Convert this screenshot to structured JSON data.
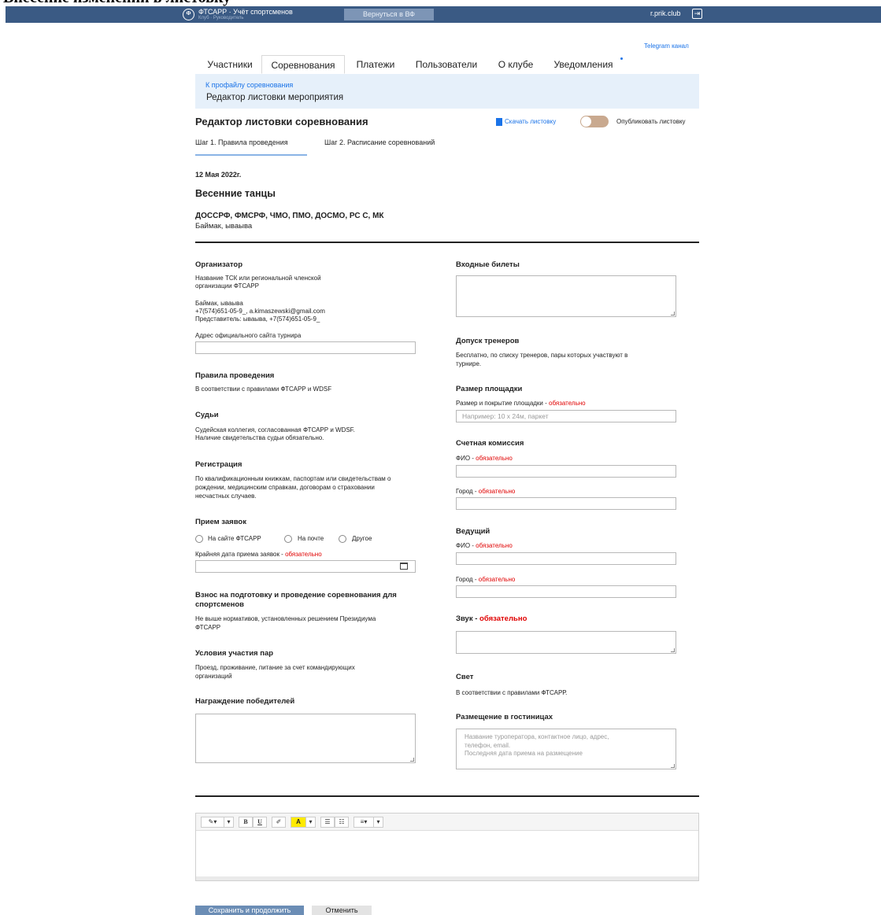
{
  "top_cut_text": "Внесение изменений в листовку",
  "topbar": {
    "logo_glyph": "Ф",
    "app_title": "ФТСАРР · Учёт спортсменов",
    "app_subtitle": "Клуб · Руководитель",
    "back_button": "Вернуться в ВФ",
    "user": "r.prik.club",
    "logout_glyph": "⇥"
  },
  "telegram_link": "Telegram канал",
  "nav": {
    "tabs": [
      {
        "label": "Участники"
      },
      {
        "label": "Соревнования"
      },
      {
        "label": "Платежи"
      },
      {
        "label": "Пользователи"
      },
      {
        "label": "О клубе"
      },
      {
        "label": "Уведомления"
      }
    ],
    "active_tab": "Соревнования"
  },
  "breadcrumb": {
    "link": "К профайлу соревнования",
    "current": "Редактор листовки мероприятия"
  },
  "page": {
    "title": "Редактор листовки соревнования",
    "download": "Скачать листовку",
    "publish_label": "Опубликовать листовку",
    "publish_on": false
  },
  "steps": [
    "Шаг 1. Правила проведения",
    "Шаг 2. Расписание соревнований"
  ],
  "event": {
    "date": "12 Мая 2022г.",
    "name": "Весенние танцы",
    "orgs": "ДОССРФ, ФМСРФ, ЧМО, ПМО, ДОСМО, РС С, МК",
    "place": "Баймак, ываыва"
  },
  "left": {
    "organizer": {
      "heading": "Организатор",
      "line1": "Название ТСК или региональной членской",
      "line2": "организации ФТСАРР",
      "line3": "Баймак, ываыва",
      "line4": "+7(574)651-05-9_, a.kimaszewski@gmail.com",
      "line5": "Представитель: ываыва, +7(574)651-05-9_"
    },
    "site_label": "Адрес официального сайта турнира",
    "site_value": "",
    "rules": {
      "heading": "Правила проведения",
      "text": "В соответствии с правилами ФТСАРР и WDSF"
    },
    "judges": {
      "heading": "Судьи",
      "line1": "Судейская коллегия, согласованная ФТСАРР и WDSF.",
      "line2": "Наличие свидетельства судьи обязательно."
    },
    "registration": {
      "heading": "Регистрация",
      "line1": "По квалификационным книжкам, паспортам или свидетельствам о",
      "line2": "рождении, медицинским справкам, договорам о страховании",
      "line3": "несчастных случаев."
    },
    "applications": {
      "heading": "Прием заявок",
      "options": [
        "На сайте ФТСАРР",
        "На почте",
        "Другое"
      ],
      "deadline_label": "Крайняя дата приема заявок",
      "required": "обязательно",
      "deadline_value": ""
    },
    "fee": {
      "heading1": "Взнос на подготовку и проведение соревнования для",
      "heading2": "спортсменов",
      "line1": "Не выше нормативов, установленных решением Президиума",
      "line2": "ФТСАРР"
    },
    "conditions": {
      "heading": "Условия участия пар",
      "line1": "Проезд, проживание, питание за счет командирующих",
      "line2": "организаций"
    },
    "awards": {
      "heading": "Награждение победителей",
      "value": ""
    }
  },
  "right": {
    "tickets": {
      "heading": "Входные билеты",
      "value": ""
    },
    "coaches": {
      "heading": "Допуск тренеров",
      "line1": "Бесплатно, по списку тренеров, пары которых участвуют в",
      "line2": "турнире."
    },
    "floor": {
      "heading": "Размер площадки",
      "label": "Размер и покрытие площадки",
      "required": "обязательно",
      "placeholder": "Например: 10 х 24м, паркет"
    },
    "counting": {
      "heading": "Счетная комиссия",
      "fio_label": "ФИО",
      "city_label": "Город",
      "required": "обязательно"
    },
    "host": {
      "heading": "Ведущий",
      "fio_label": "ФИО",
      "city_label": "Город",
      "required": "обязательно"
    },
    "sound": {
      "heading": "Звук",
      "required": "обязательно",
      "value": ""
    },
    "light": {
      "heading": "Свет",
      "text": "В соответствии с правилами ФТСАРР."
    },
    "hotel": {
      "heading": "Размещение в гостиницах",
      "ph1": "Название туроператора, контактное лицо, адрес,",
      "ph2": "телефон, email.",
      "ph3": "Последняя дата приема на размещение"
    }
  },
  "editor": {
    "tools": [
      "✎▾",
      "▾",
      "B",
      "U",
      "✐",
      "A",
      "▾",
      "☰",
      "☷",
      "≡▾",
      "▾"
    ]
  },
  "buttons": {
    "save": "Сохранить и продолжить",
    "cancel": "Отменить"
  },
  "colors": {
    "topbar": "#3a5a84",
    "accent": "#1a73e8",
    "required": "#e00000",
    "breadcrumb_bg": "#e6f0fa"
  }
}
